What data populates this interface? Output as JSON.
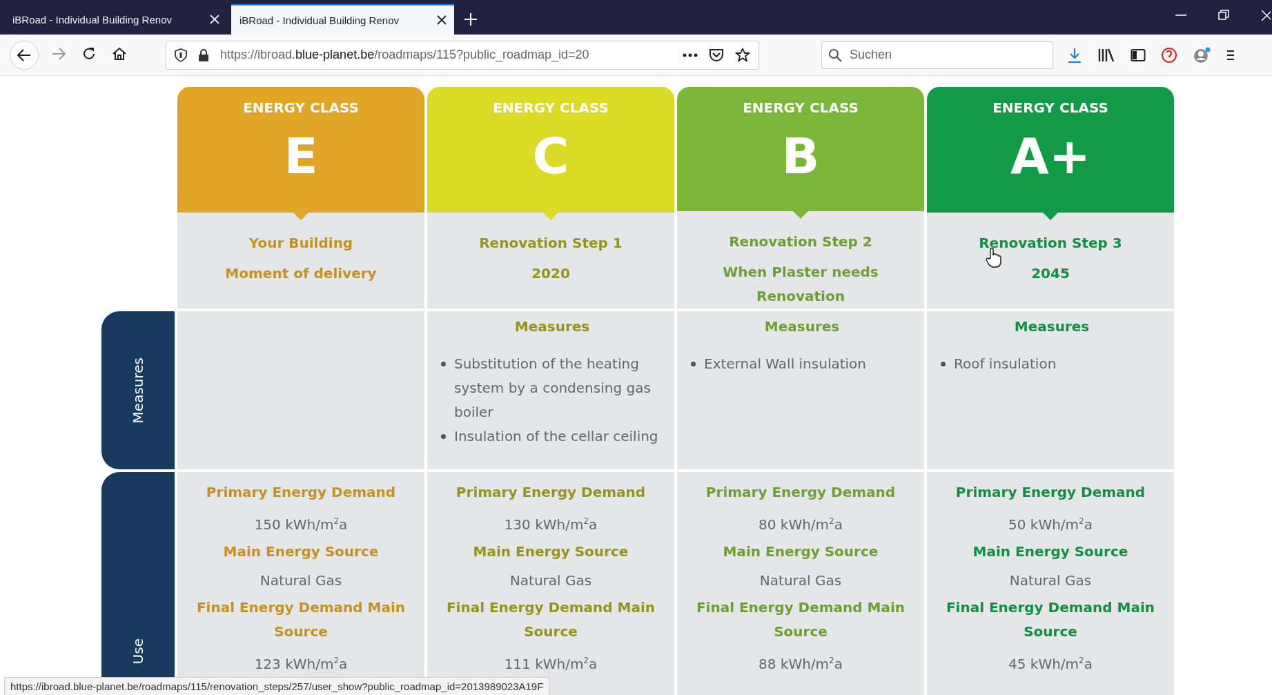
{
  "browser": {
    "tabs": [
      {
        "title": "iBRoad - Individual Building Renov",
        "selected": false
      },
      {
        "title": "iBRoad - Individual Building Renov",
        "selected": true
      }
    ],
    "url": "https://ibroad.**blue-planet.be**/roadmaps/115?public_roadmap_id=20",
    "search": {
      "placeholder": "Suchen"
    }
  },
  "row_labels": [
    "Measures",
    "Use"
  ],
  "classes": [
    {
      "heading": "ENERGY CLASS",
      "letter": "E",
      "color": "#e0a526",
      "lines": [
        "Your Building",
        "Moment of delivery"
      ],
      "energy": [
        {
          "label": "Primary Energy Demand",
          "value": "150 kWh/m$^{2}$a"
        },
        {
          "label": "Main Energy Source",
          "value": "Natural Gas"
        },
        {
          "label": "Final Energy Demand Main Source",
          "value": "123 kWh/m$^{2}$a"
        }
      ]
    },
    {
      "heading": "ENERGY CLASS",
      "letter": "C",
      "color": "#d9db26",
      "lines": [
        "Renovation Step 1",
        "2020"
      ],
      "measures": {
        "title": "Measures",
        "items": [
          "Substitution of the heating system by a condensing gas boiler",
          "Insulation of the cellar ceiling"
        ]
      },
      "energy": [
        {
          "label": "Primary Energy Demand",
          "value": "130 kWh/m$^{2}$a"
        },
        {
          "label": "Main Energy Source",
          "value": "Natural Gas"
        },
        {
          "label": "Final Energy Demand Main Source",
          "value": "111 kWh/m$^{2}$a"
        }
      ]
    },
    {
      "heading": "ENERGY CLASS",
      "letter": "B",
      "color": "#7cb639",
      "lines": [
        "Renovation Step 2",
        "When Plaster needs Renovation"
      ],
      "measures": {
        "title": "Measures",
        "items": [
          "External Wall insulation"
        ]
      },
      "energy": [
        {
          "label": "Primary Energy Demand",
          "value": "80 kWh/m$^{2}$a"
        },
        {
          "label": "Main Energy Source",
          "value": "Natural Gas"
        },
        {
          "label": "Final Energy Demand Main Source",
          "value": "88 kWh/m$^{2}$a"
        }
      ]
    },
    {
      "heading": "ENERGY CLASS",
      "letter": "A+",
      "color": "#139a47",
      "lines": [
        "Renovation Step 3",
        "2045"
      ],
      "measures": {
        "title": "Measures",
        "items": [
          "Roof insulation"
        ]
      },
      "energy": [
        {
          "label": "Primary Energy Demand",
          "value": "50 kWh/m$^{2}$a"
        },
        {
          "label": "Main Energy Source",
          "value": "Natural Gas"
        },
        {
          "label": "Final Energy Demand Main Source",
          "value": "45 kWh/m$^{2}$a"
        }
      ]
    }
  ],
  "status_url": "https://ibroad.blue-planet.be/roadmaps/115/renovation_steps/257/user_show?public_roadmap_id=2013989023A19F"
}
